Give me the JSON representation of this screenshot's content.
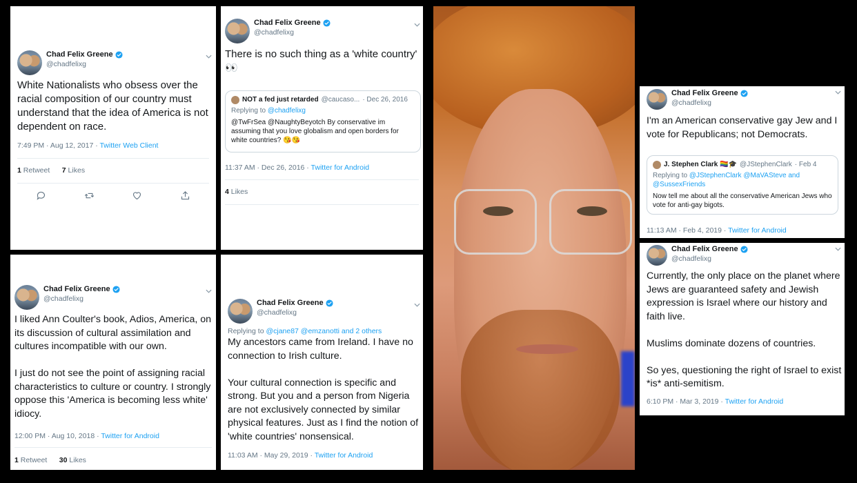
{
  "account": {
    "name": "Chad Felix Greene",
    "handle": "@chadfelixg"
  },
  "colors": {
    "link": "#1da1f2",
    "muted": "#657786",
    "text": "#14171a",
    "verified": "#1da1f2",
    "background": "#000000"
  },
  "tweets": [
    {
      "text": "White Nationalists who obsess over the racial composition of our country must understand that the idea of America is not dependent on race.",
      "time": "7:49 PM · Aug 12, 2017 · ",
      "source": "Twitter Web Client",
      "retweets": "1",
      "retweets_label": " Retweet",
      "likes": "7",
      "likes_label": " Likes"
    },
    {
      "text": "There is no such thing as a 'white country' 👀",
      "quote": {
        "name": "NOT a fed just retarded",
        "handle": "@caucaso...",
        "date": "· Dec 26, 2016",
        "replying_prefix": "Replying to ",
        "replying_to": "@chadfelixg",
        "text": "@TwFrSea @NaughtyBeyotch By conservative im assuming that you love globalism and open borders for white countries? 😘😘"
      },
      "time": "11:37 AM · Dec 26, 2016 · ",
      "source": "Twitter for Android",
      "likes": "4",
      "likes_label": " Likes"
    },
    {
      "text": "I liked Ann Coulter's book, Adios, America, on its discussion of cultural assimilation and cultures incompatible with our own.\n\nI just do not see the point of assigning racial characteristics to culture or country. I strongly oppose this 'America is becoming less white' idiocy.",
      "time": "12:00 PM · Aug 10, 2018 · ",
      "source": "Twitter for Android",
      "retweets": "1",
      "retweets_label": " Retweet",
      "likes": "30",
      "likes_label": " Likes"
    },
    {
      "replying_prefix": "Replying to ",
      "replying_to": "@cjane87 @emzanotti and 2 others",
      "text": "My ancestors came from Ireland. I have no connection to Irish culture.\n\nYour cultural connection is specific and strong. But you and a person from Nigeria are not exclusively connected by similar physical features. Just as I find the notion of 'white countries' nonsensical.",
      "time": "11:03 AM · May 29, 2019 · ",
      "source": "Twitter for Android"
    },
    {
      "text": "I'm an American conservative gay Jew and I vote for Republicans; not Democrats.",
      "quote": {
        "name": "J. Stephen Clark 🏳️‍🌈🎓",
        "handle": "@JStephenClark",
        "date": "· Feb 4",
        "replying_prefix": "Replying to ",
        "replying_to": "@JStephenClark @MaVASteve and @SussexFriends",
        "text": "Now tell me about all the conservative American Jews who vote for anti-gay bigots."
      },
      "time": "11:13 AM · Feb 4, 2019 · ",
      "source": "Twitter for Android"
    },
    {
      "text": "Currently, the only place on the planet where Jews are guaranteed safety and Jewish expression is Israel where our history and faith live.\n\nMuslims dominate dozens of countries.\n\nSo yes, questioning the right of Israel to exist *is* anti-semitism.",
      "time": "6:10 PM · Mar 3, 2019 · ",
      "source": "Twitter for Android"
    }
  ],
  "icons": {
    "reply": "reply-icon",
    "retweet": "retweet-icon",
    "like": "heart-icon",
    "share": "share-icon",
    "verified": "verified-badge-icon",
    "menu": "chevron-down-icon"
  }
}
